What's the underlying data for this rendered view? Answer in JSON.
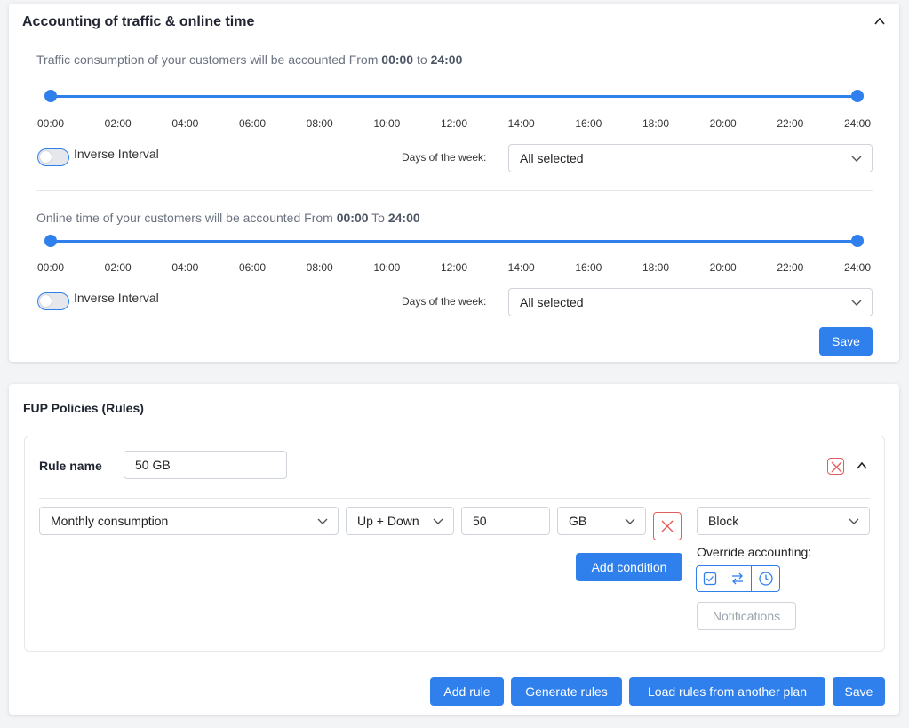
{
  "accounting": {
    "title": "Accounting of traffic & online time",
    "traffic": {
      "caption_prefix": "Traffic consumption of your customers will be accounted From",
      "from": "00:00",
      "connector": "to",
      "to": "24:00",
      "range_start_hour": 0,
      "range_end_hour": 24,
      "toggle_label": "Inverse Interval",
      "toggle_on": false,
      "days_label": "Days of the week:",
      "days_value": "All selected"
    },
    "online": {
      "caption_prefix": "Online time of your customers will be accounted From",
      "from": "00:00",
      "connector": "To",
      "to": "24:00",
      "range_start_hour": 0,
      "range_end_hour": 24,
      "toggle_label": "Inverse Interval",
      "toggle_on": false,
      "days_label": "Days of the week:",
      "days_value": "All selected"
    },
    "ticks": [
      "00:00",
      "02:00",
      "04:00",
      "06:00",
      "08:00",
      "10:00",
      "12:00",
      "14:00",
      "16:00",
      "18:00",
      "20:00",
      "22:00",
      "24:00"
    ],
    "save_label": "Save"
  },
  "fup": {
    "title": "FUP Policies (Rules)",
    "rule": {
      "name_label": "Rule name",
      "name_value": "50 GB",
      "condition": {
        "type": "Monthly consumption",
        "direction": "Up + Down",
        "amount": "50",
        "unit": "GB"
      },
      "add_condition_label": "Add condition",
      "action": "Block",
      "override_label": "Override accounting:",
      "notifications_label": "Notifications"
    },
    "buttons": {
      "add_rule": "Add rule",
      "generate_rules": "Generate rules",
      "load_rules": "Load rules from another plan",
      "save": "Save"
    }
  },
  "colors": {
    "accent": "#2f80ed",
    "danger": "#e35d5d"
  }
}
